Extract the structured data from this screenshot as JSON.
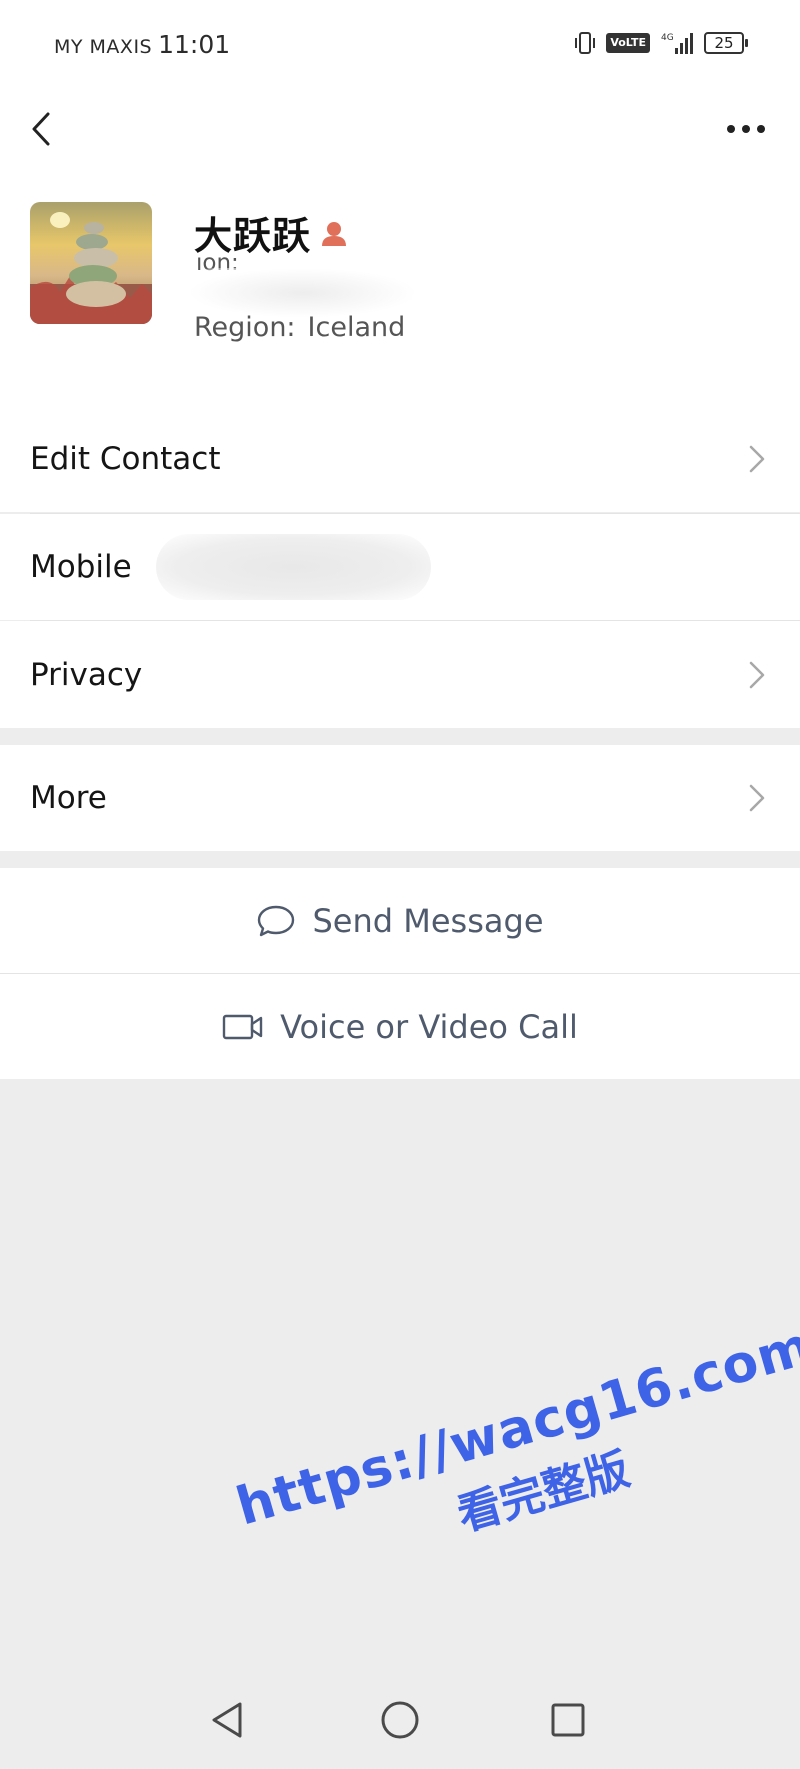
{
  "status_bar": {
    "carrier": "MY MAXIS",
    "time": "11:01",
    "volte": "VoLTE",
    "network": "4G",
    "battery": "25"
  },
  "nav": {
    "back_icon": "chevron-left-icon",
    "more_icon": "ellipsis-icon"
  },
  "profile": {
    "name": "大跃跃",
    "id_label_partial": "ıon:",
    "region_label": "Region:",
    "region_value": "Iceland",
    "badge_color": "#e0705a"
  },
  "menu": {
    "edit_contact": "Edit Contact",
    "mobile": "Mobile",
    "privacy": "Privacy",
    "more": "More"
  },
  "actions": {
    "send_message": "Send Message",
    "call": "Voice or Video Call"
  },
  "watermark": {
    "url": "https://wacg16.com",
    "text": "看完整版"
  },
  "colors": {
    "accent_text": "#4f5b6d",
    "background": "#ededed",
    "watermark": "#3e63e6"
  }
}
